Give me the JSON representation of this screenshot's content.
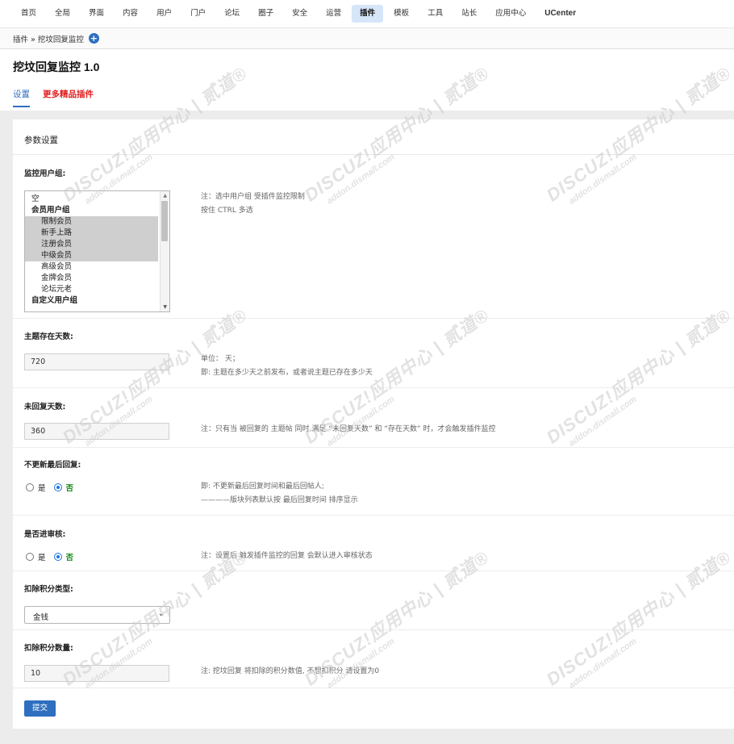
{
  "topnav": {
    "items": [
      {
        "label": "首页"
      },
      {
        "label": "全局"
      },
      {
        "label": "界面"
      },
      {
        "label": "内容"
      },
      {
        "label": "用户"
      },
      {
        "label": "门户"
      },
      {
        "label": "论坛"
      },
      {
        "label": "圈子"
      },
      {
        "label": "安全"
      },
      {
        "label": "运营"
      },
      {
        "label": "插件",
        "active": true
      },
      {
        "label": "模板"
      },
      {
        "label": "工具"
      },
      {
        "label": "站长"
      },
      {
        "label": "应用中心"
      },
      {
        "label": "UCenter"
      }
    ]
  },
  "breadcrumb": {
    "text": "插件 » 挖坟回复监控",
    "plus_icon": "add-circle-icon"
  },
  "page": {
    "title": "挖坟回复监控 1.0",
    "tabs": [
      {
        "label": "设置",
        "active": true
      },
      {
        "label": "更多精品插件"
      }
    ]
  },
  "panel": {
    "header": "参数设置",
    "fields": {
      "monitor_groups": {
        "label": "监控用户组:",
        "options": [
          {
            "label": "空",
            "type": "plain"
          },
          {
            "label": "会员用户组",
            "type": "group"
          },
          {
            "label": "限制会员",
            "type": "child",
            "selected": true
          },
          {
            "label": "新手上路",
            "type": "child",
            "selected": true
          },
          {
            "label": "注册会员",
            "type": "child",
            "selected": true
          },
          {
            "label": "中级会员",
            "type": "child",
            "selected": true
          },
          {
            "label": "高级会员",
            "type": "child"
          },
          {
            "label": "金牌会员",
            "type": "child"
          },
          {
            "label": "论坛元老",
            "type": "child"
          },
          {
            "label": "自定义用户组",
            "type": "group"
          }
        ],
        "note_line1": "注：选中用户组 受插件监控限制",
        "note_line2": "按住 CTRL 多选"
      },
      "topic_days": {
        "label": "主题存在天数:",
        "value": "720",
        "note_line1": "单位： 天；",
        "note_line2": "即: 主题在多少天之前发布，或者说主题已存在多少天"
      },
      "no_reply_days": {
        "label": "未回复天数:",
        "value": "360",
        "note_line1": "注：只有当 被回复的 主题帖 同时 满足 “未回复天数” 和 “存在天数” 时，才会触发插件监控"
      },
      "no_update_last_reply": {
        "label": "不更新最后回复:",
        "yes": "是",
        "no": "否",
        "selected": "no",
        "note_line1": "即: 不更新最后回复时间和最后回帖人;",
        "note_line2": "————版块列表默认按 最后回复时间 排序显示"
      },
      "moderate": {
        "label": "是否进审核:",
        "yes": "是",
        "no": "否",
        "selected": "no",
        "note_line1": "注：设置后 触发插件监控的回复 会默认进入审核状态"
      },
      "credit_type": {
        "label": "扣除积分类型:",
        "value": "金钱"
      },
      "credit_amount": {
        "label": "扣除积分数量:",
        "value": "10",
        "note_line1": "注: 挖坟回复 将扣除的积分数值, 不想扣积分 请设置为0"
      }
    },
    "submit_label": "提交"
  },
  "watermark": {
    "main": "DISCUZ!应用中心 | 贰道®",
    "sub": "addon.dismall.com"
  }
}
